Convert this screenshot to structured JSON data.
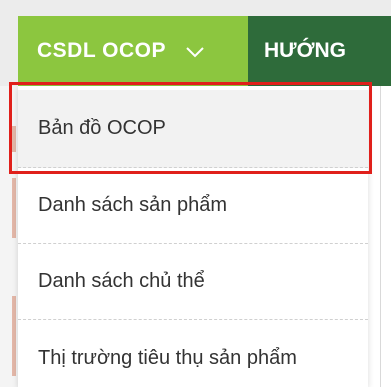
{
  "nav": {
    "active_label": "CSDL OCOP",
    "next_label": "HƯỚNG",
    "colors": {
      "active_bg": "#8cc63f",
      "next_bg": "#2e6b3a",
      "text": "#ffffff"
    },
    "active_icon": "chevron-down-icon"
  },
  "menu": {
    "items": [
      {
        "label": "Bản đồ OCOP"
      },
      {
        "label": "Danh sách sản phẩm"
      },
      {
        "label": "Danh sách chủ thể"
      },
      {
        "label": "Thị trường tiêu thụ sản phẩm"
      }
    ],
    "highlighted_index": 0,
    "highlight_color": "#e0201b"
  }
}
